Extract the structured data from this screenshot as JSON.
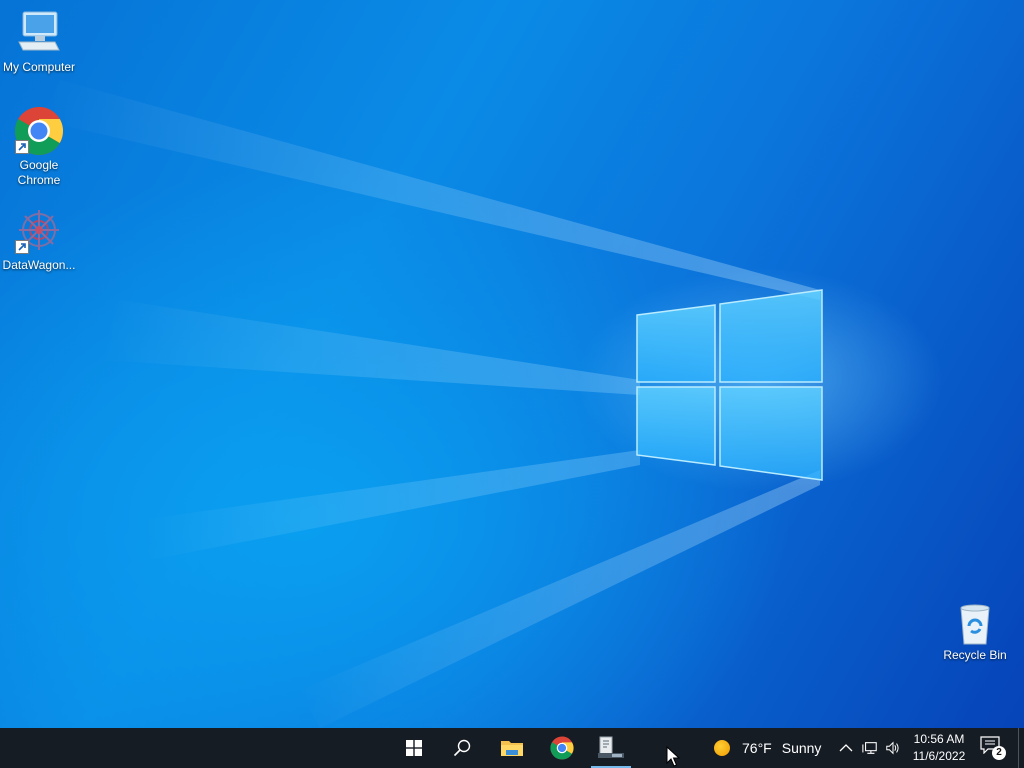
{
  "desktop": {
    "icons": [
      {
        "label": "My Computer",
        "icon": "computer-icon"
      },
      {
        "label": "Google\nChrome",
        "icon": "chrome-icon"
      },
      {
        "label": "DataWagon...",
        "icon": "datawagon-icon"
      },
      {
        "label": "Recycle Bin",
        "icon": "recycle-bin-icon"
      }
    ]
  },
  "taskbar": {
    "buttons": [
      {
        "name": "start-button",
        "icon": "windows-logo-icon"
      },
      {
        "name": "search-button",
        "icon": "search-icon"
      },
      {
        "name": "file-explorer-button",
        "icon": "folder-icon"
      },
      {
        "name": "chrome-taskbar-button",
        "icon": "chrome-icon"
      },
      {
        "name": "app-taskbar-button",
        "icon": "document-app-icon",
        "active": true
      }
    ],
    "weather": {
      "temp": "76°F",
      "condition": "Sunny",
      "icon": "sun-icon"
    },
    "tray": {
      "icons": [
        "chevron-up-icon",
        "network-icon",
        "volume-icon"
      ],
      "time": "10:56 AM",
      "date": "11/6/2022",
      "notification_count": "2"
    }
  },
  "colors": {
    "taskbar_bg": "#161c24",
    "active_indicator": "#76b9ed",
    "desktop_accent": "#0a8be6"
  }
}
